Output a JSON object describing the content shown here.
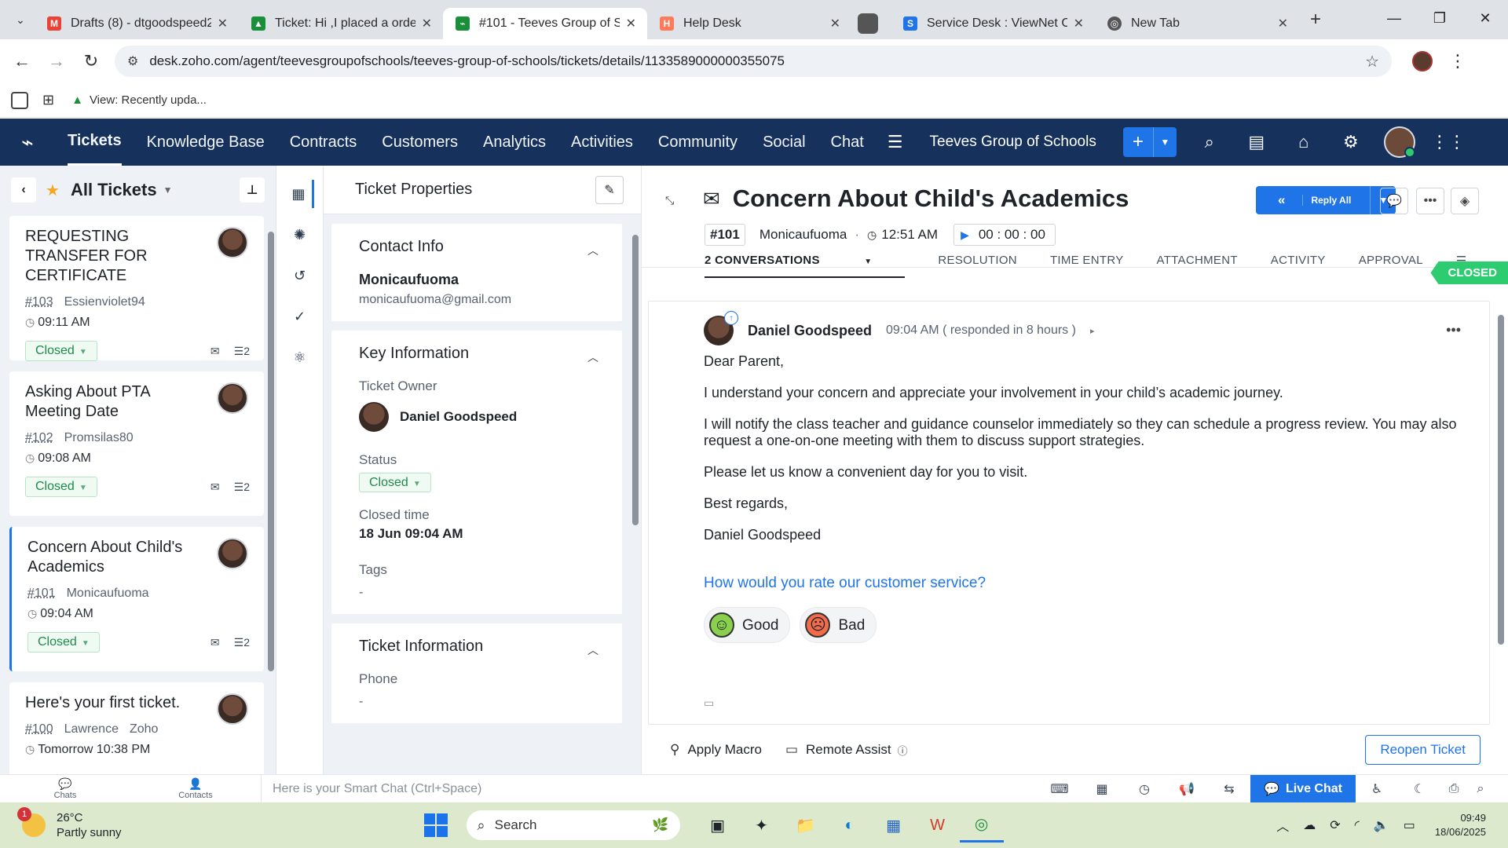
{
  "browser": {
    "tabs": [
      {
        "title": "Drafts (8) - dtgoodspeed2",
        "icon": "gmail-icon",
        "color": "#ea4335"
      },
      {
        "title": "Ticket: Hi ,I placed a orde",
        "icon": "zoho-leaf-icon",
        "color": "#1a8f3a"
      },
      {
        "title": "#101 - Teeves Group of S",
        "icon": "zoho-desk-icon",
        "color": "#1a8f3a",
        "active": true
      },
      {
        "title": "Help Desk",
        "icon": "hubspot-icon",
        "color": "#ff7a59"
      },
      {
        "title": "",
        "icon": "app-icon",
        "color": "#555"
      },
      {
        "title": "Service Desk : ViewNet C",
        "icon": "service-desk-icon",
        "color": "#1f74e8"
      },
      {
        "title": "New Tab",
        "icon": "chrome-icon",
        "color": "#555"
      }
    ],
    "url": "desk.zoho.com/agent/teevesgroupofschools/teeves-group-of-schools/tickets/details/1133589000000355075",
    "bookmark": "View: Recently upda..."
  },
  "topnav": {
    "items": [
      "Tickets",
      "Knowledge Base",
      "Contracts",
      "Customers",
      "Analytics",
      "Activities",
      "Community",
      "Social",
      "Chat"
    ],
    "org": "Teeves Group of Schools"
  },
  "ticketlist": {
    "title": "All Tickets",
    "tickets": [
      {
        "subject": "REQUESTING TRANSFER FOR CERTIFICATE",
        "number": "#103",
        "contact": "Essienviolet94",
        "time": "09:11 AM",
        "status": "Closed",
        "threads": "2"
      },
      {
        "subject": "Asking About PTA Meeting Date",
        "number": "#102",
        "contact": "Promsilas80",
        "time": "09:08 AM",
        "status": "Closed",
        "threads": "2"
      },
      {
        "subject": "Concern About Child's Academics",
        "number": "#101",
        "contact": "Monicaufuoma",
        "time": "09:04 AM",
        "status": "Closed",
        "threads": "2"
      },
      {
        "subject": "Here's your first ticket.",
        "number": "#100",
        "contact": "Lawrence",
        "account": "Zoho",
        "time": "Tomorrow 10:38 PM"
      }
    ]
  },
  "props": {
    "title": "Ticket Properties",
    "contact": {
      "heading": "Contact Info",
      "name": "Monicaufuoma",
      "email": "monicaufuoma@gmail.com"
    },
    "key": {
      "heading": "Key Information",
      "owner_label": "Ticket Owner",
      "owner": "Daniel Goodspeed",
      "status_label": "Status",
      "status": "Closed",
      "closed_label": "Closed time",
      "closed": "18 Jun 09:04 AM",
      "tags_label": "Tags",
      "tags": "-"
    },
    "info": {
      "heading": "Ticket Information",
      "phone_label": "Phone",
      "phone": "-"
    }
  },
  "ticket": {
    "title": "Concern About Child's Academics",
    "number": "#101",
    "contact": "Monicaufuoma",
    "time": "12:51 AM",
    "timer": "00 : 00 : 00",
    "reply_label": "Reply All",
    "tabs": [
      "2 CONVERSATIONS",
      "RESOLUTION",
      "TIME ENTRY",
      "ATTACHMENT",
      "ACTIVITY",
      "APPROVAL"
    ],
    "status_flag": "CLOSED",
    "conversation": {
      "author": "Daniel Goodspeed",
      "time": "09:04 AM ( responded in 8 hours )",
      "lines": [
        "Dear Parent,",
        "I understand your concern and appreciate your involvement in your child’s academic journey.",
        "I will notify the class teacher and guidance counselor immediately so they can schedule a progress review. You may also request a one-on-one meeting with them to discuss support strategies.",
        "Please let us know a convenient day for you to visit.",
        "Best regards,",
        "Daniel Goodspeed"
      ],
      "rating_question": "How would you rate our customer service?",
      "good": "Good",
      "bad": "Bad"
    },
    "footer": {
      "macro": "Apply Macro",
      "remote": "Remote Assist",
      "reopen": "Reopen Ticket"
    }
  },
  "appbar": {
    "chats": "Chats",
    "contacts": "Contacts",
    "smartchat_placeholder": "Here is your Smart Chat (Ctrl+Space)",
    "livechat": "Live Chat"
  },
  "taskbar": {
    "temp": "26°C",
    "weather": "Partly sunny",
    "search": "Search",
    "time": "09:49",
    "date": "18/06/2025",
    "badge": "1"
  }
}
